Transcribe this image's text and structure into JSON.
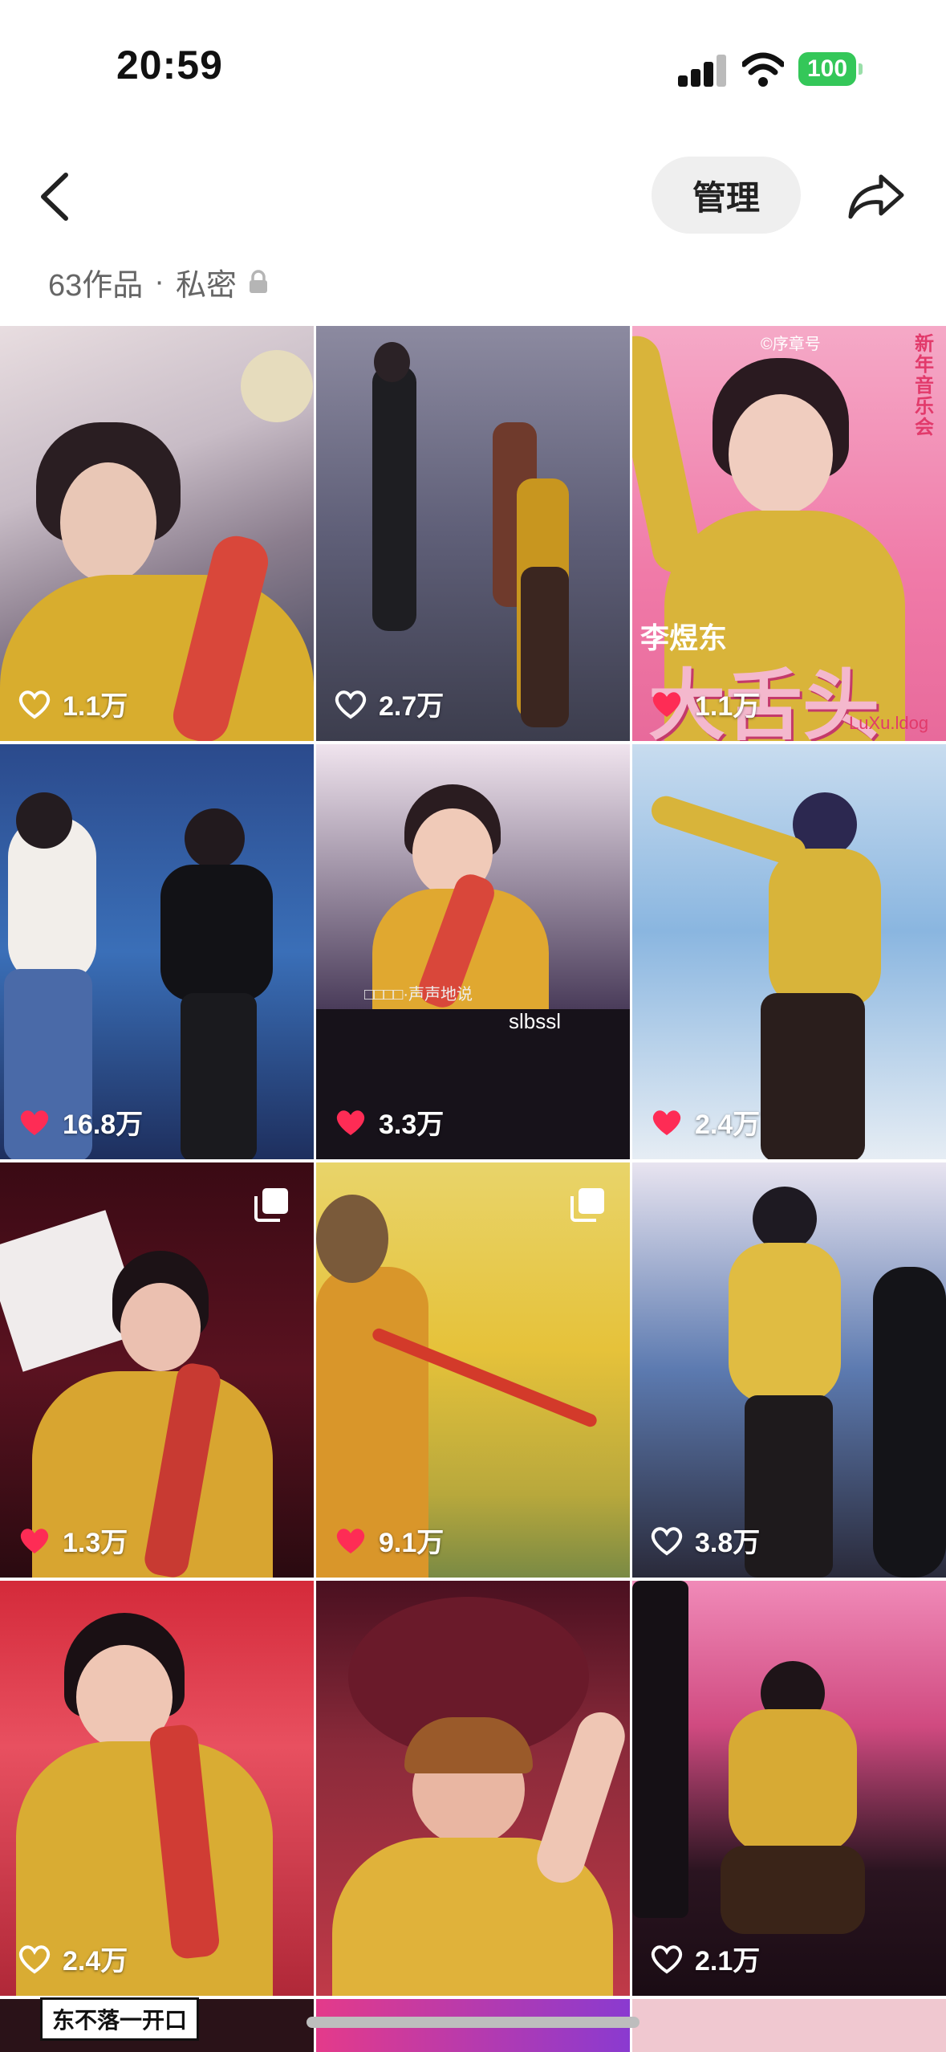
{
  "status": {
    "time": "20:59",
    "battery": "100"
  },
  "header": {
    "manage_label": "管理"
  },
  "meta": {
    "works": "63作品",
    "separator": "·",
    "privacy": "私密"
  },
  "colors": {
    "like_filled": "#fe2c55",
    "battery_green": "#34c759",
    "manage_bg": "#efefef"
  },
  "icons": {
    "back": "chevron-left-icon",
    "share": "share-arrow-icon",
    "lock": "lock-icon",
    "heart": "heart-icon",
    "multi": "multi-image-icon"
  },
  "grid": {
    "tiles": [
      {
        "likes": "1.1万",
        "liked": false
      },
      {
        "likes": "2.7万",
        "liked": false
      },
      {
        "likes": "1.1万",
        "liked": true,
        "overlay_top": "©序章号",
        "overlay_side": "新年音乐会",
        "overlay_name": "李煜东",
        "overlay_big": "大舌头",
        "overlay_small": "LuXu.ldog"
      },
      {
        "likes": "16.8万",
        "liked": true
      },
      {
        "likes": "3.3万",
        "liked": true,
        "caption_1": "□□□□·声声地说",
        "caption_2": "slbssl"
      },
      {
        "likes": "2.4万",
        "liked": true
      },
      {
        "likes": "1.3万",
        "liked": true,
        "multi": true
      },
      {
        "likes": "9.1万",
        "liked": true,
        "multi": true
      },
      {
        "likes": "3.8万",
        "liked": false
      },
      {
        "likes": "2.4万",
        "liked": false
      },
      {
        "likes": "",
        "liked": false
      },
      {
        "likes": "2.1万",
        "liked": false
      }
    ]
  },
  "bottom_peek": {
    "label": "东不落一开口"
  }
}
